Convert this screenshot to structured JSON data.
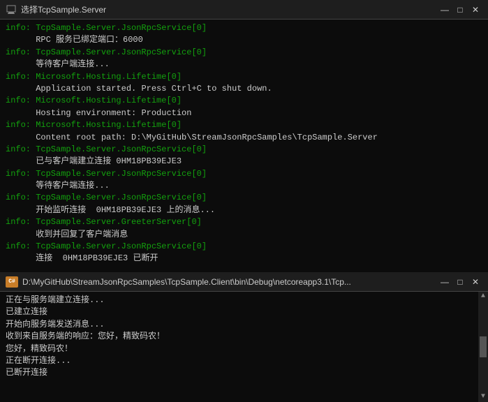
{
  "windows": {
    "server": {
      "title": "选择TcpSample.Server",
      "icon_label": "□",
      "controls": [
        "—",
        "□",
        "✕"
      ],
      "lines": [
        {
          "type": "info",
          "text": "info: TcpSample.Server.JsonRpcService[0]"
        },
        {
          "type": "white",
          "text": "      RPC 服务已绑定端口：6000"
        },
        {
          "type": "info",
          "text": "info: TcpSample.Server.JsonRpcService[0]"
        },
        {
          "type": "white",
          "text": "      等待客户端连接..."
        },
        {
          "type": "info",
          "text": "info: Microsoft.Hosting.Lifetime[0]"
        },
        {
          "type": "white",
          "text": "      Application started. Press Ctrl+C to shut down."
        },
        {
          "type": "info",
          "text": "info: Microsoft.Hosting.Lifetime[0]"
        },
        {
          "type": "white",
          "text": "      Hosting environment: Production"
        },
        {
          "type": "info",
          "text": "info: Microsoft.Hosting.Lifetime[0]"
        },
        {
          "type": "white",
          "text": "      Content root path: D:\\MyGitHub\\StreamJsonRpcSamples\\TcpSample.Server"
        },
        {
          "type": "info",
          "text": "info: TcpSample.Server.JsonRpcService[0]"
        },
        {
          "type": "white",
          "text": "      已与客户端建立连接 0HM18PB39EJE3"
        },
        {
          "type": "info",
          "text": "info: TcpSample.Server.JsonRpcService[0]"
        },
        {
          "type": "white",
          "text": "      等待客户端连接..."
        },
        {
          "type": "info",
          "text": "info: TcpSample.Server.JsonRpcService[0]"
        },
        {
          "type": "white",
          "text": "      开始监听连接  0HM18PB39EJE3 上的消息..."
        },
        {
          "type": "info",
          "text": "info: TcpSample.Server.GreeterServer[0]"
        },
        {
          "type": "white",
          "text": "      收到并回复了客户端消息"
        },
        {
          "type": "info",
          "text": "info: TcpSample.Server.JsonRpcService[0]"
        },
        {
          "type": "white",
          "text": "      连接  0HM18PB39EJE3 已断开"
        }
      ]
    },
    "client": {
      "title": "D:\\MyGitHub\\StreamJsonRpcSamples\\TcpSample.Client\\bin\\Debug\\netcoreapp3.1\\Tcp...",
      "icon_label": "C#",
      "controls": [
        "—",
        "□",
        "✕"
      ],
      "lines": [
        {
          "type": "white",
          "text": "正在与服务端建立连接..."
        },
        {
          "type": "white",
          "text": "已建立连接"
        },
        {
          "type": "white",
          "text": "开始向服务端发送消息..."
        },
        {
          "type": "white",
          "text": "收到来自服务端的响应：您好，精致码农！"
        },
        {
          "type": "white",
          "text": "您好，精致码农！"
        },
        {
          "type": "white",
          "text": "正在断开连接..."
        },
        {
          "type": "white",
          "text": "已断开连接"
        }
      ]
    }
  }
}
